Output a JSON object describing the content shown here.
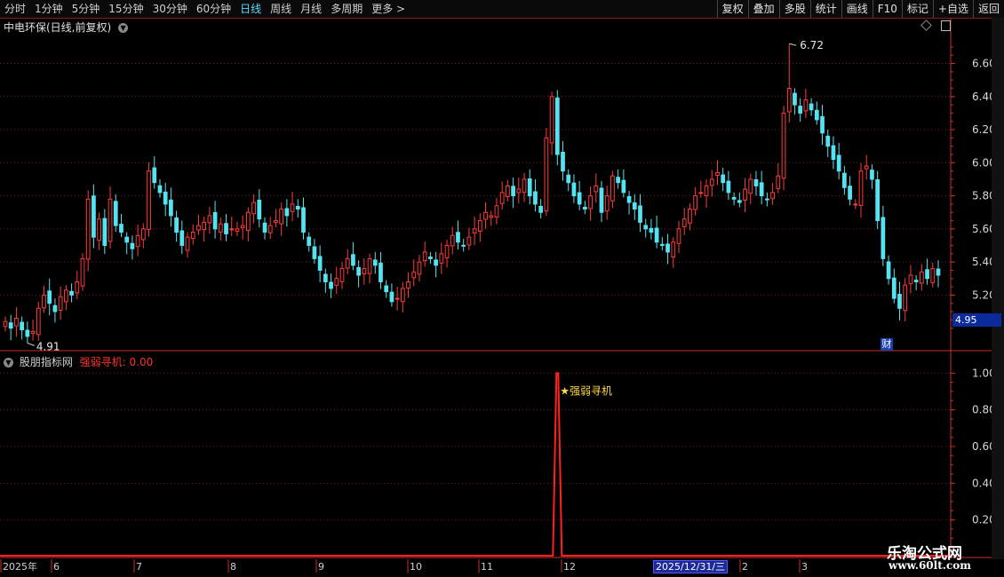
{
  "toolbar": {
    "periods": [
      "分时",
      "1分钟",
      "5分钟",
      "15分钟",
      "30分钟",
      "60分钟",
      "日线",
      "周线",
      "月线",
      "多周期",
      "更多 >"
    ],
    "active": "日线",
    "right_buttons": [
      "复权",
      "叠加",
      "多股",
      "统计",
      "画线",
      "F10",
      "标记",
      "+自选",
      "返回"
    ]
  },
  "main": {
    "title": "中电环保(日线,前复权)",
    "chevron_icon": "chevron-down-icon",
    "high_marker": "6.72",
    "low_marker": "4.91",
    "current_price_box": "4.95",
    "fin_badge": "财"
  },
  "indicator": {
    "name": "股朋指标网",
    "formula": "强弱寻机: 0.00",
    "signal_label": "★强弱寻机"
  },
  "watermark": {
    "title": "乐淘公式网",
    "url": "www.60lt.com"
  },
  "colors": {
    "up": "#ff3b3b",
    "down": "#54e3f0",
    "grid": "#7a1f1f",
    "axis": "#c8302a",
    "signal": "#ff2020"
  },
  "chart_data": [
    {
      "type": "candlestick",
      "title": "中电环保(日线,前复权)",
      "y_ticks": [
        "5.20",
        "5.40",
        "5.60",
        "5.80",
        "6.00",
        "6.20",
        "6.40",
        "6.60"
      ],
      "ylim": [
        4.88,
        6.78
      ],
      "grid": true,
      "x_labels": [
        "2025年",
        "6",
        "7",
        "8",
        "9",
        "10",
        "11",
        "12",
        "2025/12/31/三",
        "2",
        "3"
      ],
      "annotations": [
        {
          "label": "6.72",
          "type": "high"
        },
        {
          "label": "4.91",
          "type": "low"
        }
      ],
      "close_values": [
        5.04,
        5.0,
        5.06,
        4.99,
        4.95,
        4.98,
        5.12,
        5.2,
        5.15,
        5.1,
        5.19,
        5.23,
        5.2,
        5.28,
        5.42,
        5.78,
        5.55,
        5.66,
        5.5,
        5.78,
        5.62,
        5.58,
        5.52,
        5.48,
        5.56,
        5.6,
        5.95,
        5.88,
        5.82,
        5.75,
        5.68,
        5.58,
        5.5,
        5.55,
        5.58,
        5.62,
        5.64,
        5.68,
        5.6,
        5.63,
        5.57,
        5.6,
        5.6,
        5.62,
        5.7,
        5.76,
        5.66,
        5.58,
        5.62,
        5.65,
        5.72,
        5.68,
        5.75,
        5.72,
        5.58,
        5.5,
        5.42,
        5.35,
        5.28,
        5.24,
        5.3,
        5.36,
        5.42,
        5.38,
        5.32,
        5.36,
        5.42,
        5.38,
        5.28,
        5.22,
        5.16,
        5.18,
        5.24,
        5.28,
        5.34,
        5.4,
        5.46,
        5.42,
        5.38,
        5.45,
        5.5,
        5.56,
        5.52,
        5.5,
        5.55,
        5.6,
        5.65,
        5.7,
        5.68,
        5.74,
        5.82,
        5.86,
        5.8,
        5.84,
        5.9,
        5.8,
        5.75,
        5.7,
        6.15,
        6.4,
        6.05,
        5.95,
        5.88,
        5.8,
        5.75,
        5.72,
        5.8,
        5.86,
        5.7,
        5.8,
        5.92,
        5.88,
        5.82,
        5.76,
        5.72,
        5.64,
        5.6,
        5.58,
        5.52,
        5.5,
        5.46,
        5.52,
        5.6,
        5.66,
        5.72,
        5.8,
        5.82,
        5.86,
        5.9,
        5.94,
        5.88,
        5.82,
        5.78,
        5.76,
        5.84,
        5.9,
        5.86,
        5.8,
        5.78,
        5.82,
        5.92,
        6.3,
        6.45,
        6.35,
        6.3,
        6.38,
        6.32,
        6.26,
        6.18,
        6.1,
        6.02,
        5.95,
        5.85,
        5.78,
        5.75,
        5.95,
        5.98,
        5.9,
        5.65,
        5.42,
        5.3,
        5.18,
        5.12,
        5.26,
        5.32,
        5.28,
        5.34,
        5.3,
        5.36,
        5.32
      ],
      "series": [
        {
          "name": "强弱寻机",
          "type": "line",
          "y_ticks": [
            "0.20",
            "0.40",
            "0.60",
            "0.80",
            "1.00"
          ],
          "ylim": [
            0,
            1.05
          ],
          "signal_at_index": 100,
          "signal_value": 1.0
        }
      ]
    }
  ]
}
